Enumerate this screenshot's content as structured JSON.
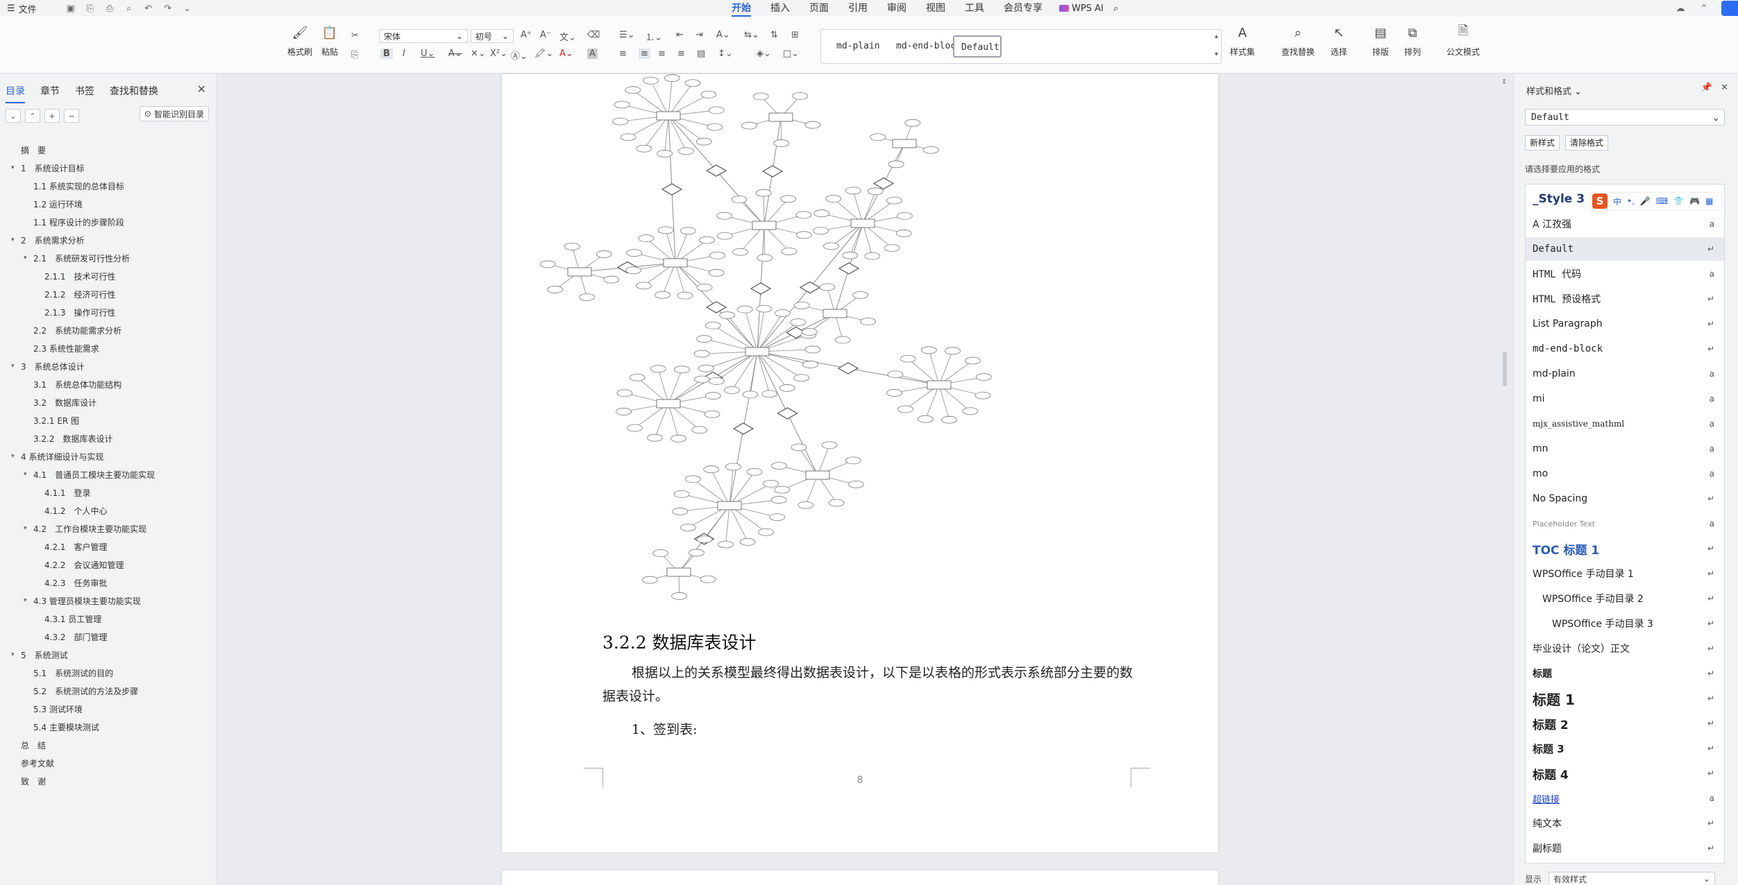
{
  "menubar": {
    "file_label": "文件",
    "tabs": [
      {
        "label": "开始",
        "active": true
      },
      {
        "label": "插入"
      },
      {
        "label": "页面"
      },
      {
        "label": "引用"
      },
      {
        "label": "审阅"
      },
      {
        "label": "视图"
      },
      {
        "label": "工具"
      },
      {
        "label": "会员专享"
      }
    ],
    "wps_ai": "WPS AI"
  },
  "ribbon": {
    "format_painter": "格式刷",
    "paste": "粘贴",
    "font_name": "宋体",
    "font_size": "初号",
    "styles": [
      "md-plain",
      "md-end-bloc",
      "Default"
    ],
    "style_set": "样式集",
    "find_replace": "查找替换",
    "select": "选择",
    "layout": "排版",
    "arrange": "排列",
    "official_mode": "公文模式"
  },
  "nav": {
    "tabs": [
      "目录",
      "章节",
      "书签",
      "查找和替换"
    ],
    "smart_toc": "智能识别目录",
    "toc": [
      {
        "label": "摘　要",
        "level": 0
      },
      {
        "label": "1　系统设计目标",
        "level": 0,
        "arrow": true
      },
      {
        "label": "1.1 系统实现的总体目标",
        "level": 1
      },
      {
        "label": "1.2 运行环境",
        "level": 1
      },
      {
        "label": "1.1 程序设计的步骤阶段",
        "level": 1
      },
      {
        "label": "2　系统需求分析",
        "level": 0,
        "arrow": true
      },
      {
        "label": "2.1　系统研发可行性分析",
        "level": 1,
        "arrow": true
      },
      {
        "label": "2.1.1　技术可行性",
        "level": 2
      },
      {
        "label": "2.1.2　经济可行性",
        "level": 2
      },
      {
        "label": "2.1.3　操作可行性",
        "level": 2
      },
      {
        "label": "2.2　系统功能需求分析",
        "level": 1
      },
      {
        "label": "2.3 系统性能需求",
        "level": 1
      },
      {
        "label": "3　系统总体设计",
        "level": 0,
        "arrow": true
      },
      {
        "label": "3.1　系统总体功能结构",
        "level": 1
      },
      {
        "label": "3.2　数据库设计",
        "level": 1
      },
      {
        "label": "3.2.1 ER 图",
        "level": 1
      },
      {
        "label": "3.2.2　数据库表设计",
        "level": 1
      },
      {
        "label": "4 系统详细设计与实现",
        "level": 0,
        "arrow": true
      },
      {
        "label": "4.1　普通员工模块主要功能实现",
        "level": 1,
        "arrow": true
      },
      {
        "label": "4.1.1　登录",
        "level": 2
      },
      {
        "label": "4.1.2　个人中心",
        "level": 2
      },
      {
        "label": "4.2　工作台模块主要功能实现",
        "level": 1,
        "arrow": true
      },
      {
        "label": "4.2.1　客户管理",
        "level": 2
      },
      {
        "label": "4.2.2　会议通知管理",
        "level": 2
      },
      {
        "label": "4.2.3　任务审批",
        "level": 2
      },
      {
        "label": "4.3 管理员模块主要功能实现",
        "level": 1,
        "arrow": true
      },
      {
        "label": "4.3.1 员工管理",
        "level": 2
      },
      {
        "label": "4.3.2　部门管理",
        "level": 2
      },
      {
        "label": "5　系统测试",
        "level": 0,
        "arrow": true
      },
      {
        "label": "5.1　系统测试的目的",
        "level": 1
      },
      {
        "label": "5.2　系统测试的方法及步骤",
        "level": 1
      },
      {
        "label": "5.3 测试环境",
        "level": 1
      },
      {
        "label": "5.4 主要模块测试",
        "level": 1
      },
      {
        "label": "总　结",
        "level": 0
      },
      {
        "label": "参考文献",
        "level": 0
      },
      {
        "label": "致　谢",
        "level": 0
      }
    ]
  },
  "doc": {
    "heading": "3.2.2  数据库表设计",
    "paragraph": "根据以上的关系模型最终得出数据表设计，以下是以表格的形式表示系统部分主要的数据表设计。",
    "subheading": "1、签到表:",
    "page_number": "8"
  },
  "styles_panel": {
    "title": "样式和格式",
    "current_style": "Default",
    "new_style": "新样式",
    "clear_format": "清除格式",
    "choose_label": "请选择要应用的格式",
    "styles": [
      {
        "name": "_Style 3",
        "mark": "↵"
      },
      {
        "name": "A 江孜强",
        "mark": "a"
      },
      {
        "name": "Default",
        "mark": "↵",
        "selected": true
      },
      {
        "name": "HTML 代码",
        "mark": "a"
      },
      {
        "name": "HTML 预设格式",
        "mark": "↵"
      },
      {
        "name": "List Paragraph",
        "mark": "↵"
      },
      {
        "name": "md-end-block",
        "mark": "↵"
      },
      {
        "name": "md-plain",
        "mark": "a"
      },
      {
        "name": "mi",
        "mark": "a"
      },
      {
        "name": "mjx_assistive_mathml",
        "mark": "a"
      },
      {
        "name": "mn",
        "mark": "a"
      },
      {
        "name": "mo",
        "mark": "a"
      },
      {
        "name": "No Spacing",
        "mark": "↵"
      },
      {
        "name": "Placeholder Text",
        "mark": "a"
      },
      {
        "name": "TOC 标题 1",
        "mark": "↵"
      },
      {
        "name": "WPSOffice 手动目录 1",
        "mark": "↵"
      },
      {
        "name": "WPSOffice 手动目录 2",
        "mark": "↵"
      },
      {
        "name": "WPSOffice 手动目录 3",
        "mark": "↵"
      },
      {
        "name": "毕业设计（论文）正文",
        "mark": "↵"
      },
      {
        "name": "标题",
        "mark": "↵"
      },
      {
        "name": "标题 1",
        "mark": "↵"
      },
      {
        "name": "标题 2",
        "mark": "↵"
      },
      {
        "name": "标题 3",
        "mark": "↵"
      },
      {
        "name": "标题 4",
        "mark": "↵"
      },
      {
        "name": "超链接",
        "mark": "a"
      },
      {
        "name": "纯文本",
        "mark": "↵"
      },
      {
        "name": "副标题",
        "mark": "↵"
      }
    ],
    "show_label": "显示",
    "show_value": "有效样式",
    "ime_labels": [
      "中",
      "•,",
      "🎤",
      "⌨",
      "👕",
      "🎮",
      "▦"
    ]
  },
  "colors": {
    "accent": "#2b65d9",
    "ime": "#e8541e"
  }
}
